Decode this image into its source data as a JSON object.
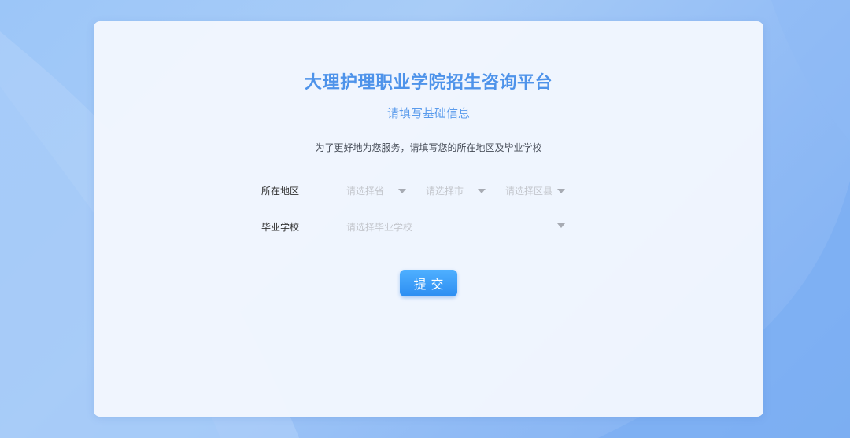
{
  "page": {
    "title": "大理护理职业学院招生咨询平台",
    "section_title": "请填写基础信息",
    "subtitle": "为了更好地为您服务，请填写您的所在地区及毕业学校"
  },
  "form": {
    "region": {
      "label": "所在地区",
      "province_placeholder": "请选择省",
      "city_placeholder": "请选择市",
      "county_placeholder": "请选择区县"
    },
    "school": {
      "label": "毕业学校",
      "placeholder": "请选择毕业学校"
    },
    "submit_label": "提交"
  },
  "colors": {
    "accent": "#4e93ea",
    "button": "#2c8ef2",
    "background": "#9cc6f8"
  }
}
